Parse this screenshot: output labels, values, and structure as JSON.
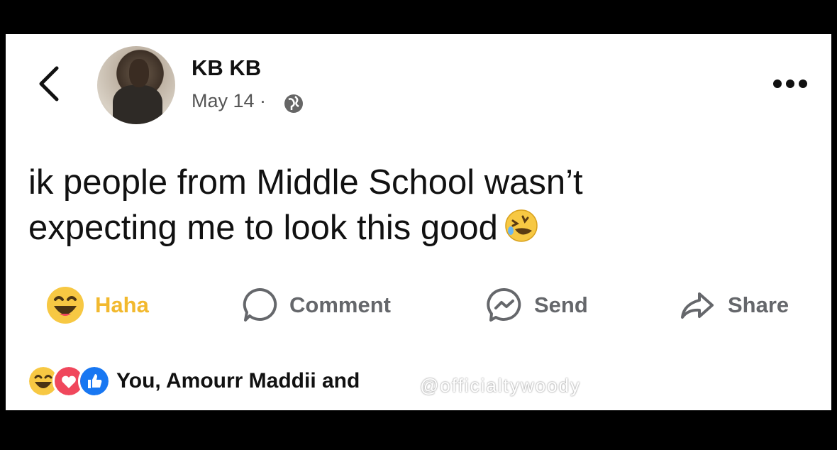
{
  "post": {
    "author": "KB KB",
    "date": "May 14 ·",
    "text_line1": "ik people from Middle School wasn’t",
    "text_line2": "expecting me to look this good",
    "emoji": "rolling-on-floor-laughing-emoji"
  },
  "actions": {
    "haha": "Haha",
    "comment": "Comment",
    "send": "Send",
    "share": "Share"
  },
  "reactions": {
    "icons": [
      "haha-reaction-icon",
      "love-reaction-icon",
      "like-reaction-icon"
    ],
    "summary": "You, Amourr Maddii and"
  },
  "watermark": "@officialtywoody",
  "colors": {
    "haha_yellow": "#f7c843",
    "love_red": "#f0475c",
    "like_blue": "#1877f2",
    "action_gray": "#65676b"
  }
}
